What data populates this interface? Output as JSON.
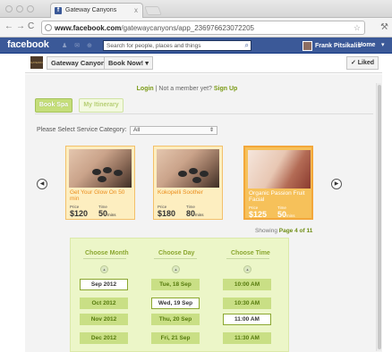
{
  "browser": {
    "tab_title": "Gateway Canyons",
    "tab_icon_letter": "f",
    "tab_close": "x",
    "url_domain": "www.facebook.com",
    "url_path": "/gatewaycanyons/app_236976623072205",
    "back_icon": "←",
    "forward_icon": "→",
    "reload_icon": "C",
    "star_icon": "☆",
    "wrench_icon": "⚒"
  },
  "fb": {
    "logo": "facebook",
    "jewels": "♟ ✉ ⊕",
    "search_placeholder": "Search for people, places and things",
    "search_icon": "⌕",
    "user_name": "Frank Pitsikalis",
    "home": "Home",
    "menu_arrow": "▾"
  },
  "page": {
    "thumb_text": "GATEWAY",
    "name": "Gateway Canyons",
    "book_now": "Book Now! ▾",
    "liked": "✓ Liked"
  },
  "app": {
    "login_link": "Login",
    "not_member": " | Not a member yet? ",
    "signup_link": "Sign Up",
    "tabs": {
      "book_spa": "Book Spa",
      "itinerary": "My Itinerary"
    },
    "service_label": "Please Select Service Category:",
    "service_value": "All",
    "prev_arrow": "◀",
    "next_arrow": "▶",
    "cards": [
      {
        "title": "Get Your Glow On 50 min",
        "price_label": "Price",
        "time_label": "Time",
        "price": "$120",
        "time": "50",
        "time_unit": "mins",
        "selected": false
      },
      {
        "title": "Kokopelli Soother",
        "price_label": "Price",
        "time_label": "Time",
        "price": "$180",
        "time": "80",
        "time_unit": "mins",
        "selected": false
      },
      {
        "title": "Organic Passion Fruit Facial",
        "price_label": "Price",
        "time_label": "Time",
        "price": "$125",
        "time": "50",
        "time_unit": "mins",
        "selected": true
      }
    ],
    "pager_prefix": "Showing ",
    "pager_value": "Page 4 of 11",
    "picker": {
      "month_title": "Choose Month",
      "day_title": "Choose Day",
      "time_title": "Choose Time",
      "up_icon": "▲",
      "months": [
        "Sep 2012",
        "Oct 2012",
        "Nov 2012",
        "Dec 2012"
      ],
      "days": [
        "Tue, 18 Sep",
        "Wed, 19 Sep",
        "Thu, 20 Sep",
        "Fri, 21 Sep"
      ],
      "times": [
        "10:00 AM",
        "10:30 AM",
        "11:00 AM",
        "11:30 AM"
      ],
      "selected_month": 0,
      "selected_day": 1,
      "selected_time": 2
    }
  }
}
